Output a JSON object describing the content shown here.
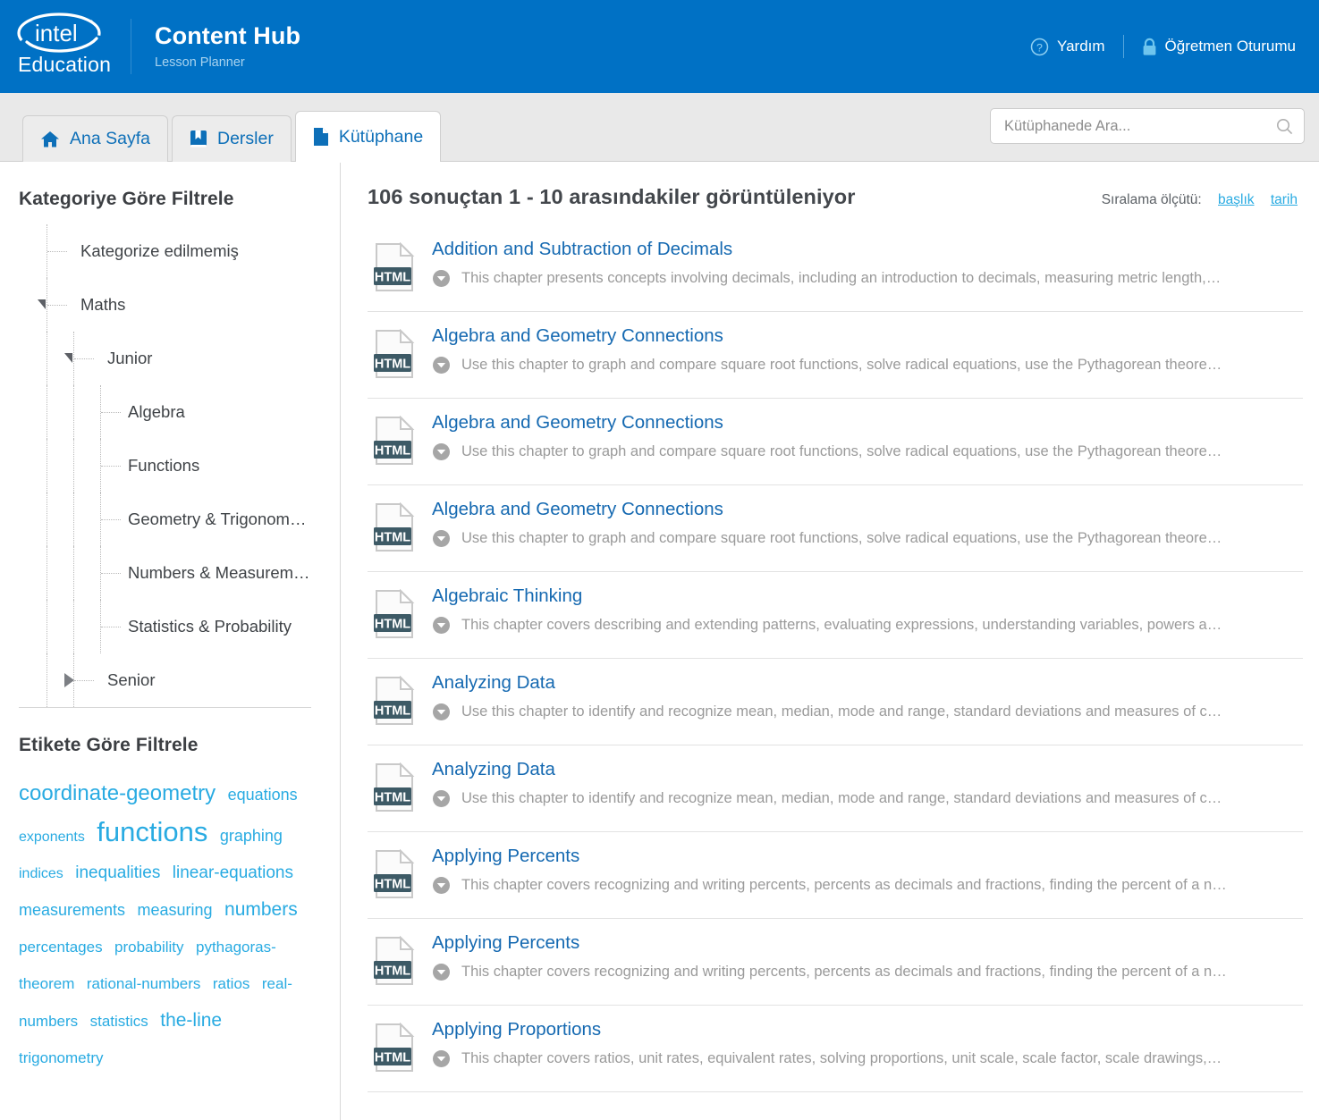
{
  "header": {
    "logo_text": "Education",
    "logo_name": "intel",
    "app_title": "Content Hub",
    "app_subtitle": "Lesson Planner",
    "help_label": "Yardım",
    "help_icon": "question-circle-icon",
    "session_label": "Öğretmen Oturumu",
    "session_icon": "lock-icon",
    "brand_color": "#0071c5"
  },
  "tabs": [
    {
      "label": "Ana Sayfa",
      "icon": "home-icon",
      "active": false
    },
    {
      "label": "Dersler",
      "icon": "book-icon",
      "active": false
    },
    {
      "label": "Kütüphane",
      "icon": "document-icon",
      "active": true
    }
  ],
  "search": {
    "placeholder": "Kütüphanede Ara...",
    "value": "",
    "icon": "search-icon"
  },
  "sidebar": {
    "category_heading": "Kategoriye Göre Filtrele",
    "tag_heading": "Etikete Göre Filtrele",
    "tree": [
      {
        "label": "Kategorize edilmemiş",
        "depth": 0,
        "caret": "none"
      },
      {
        "label": "Maths",
        "depth": 0,
        "caret": "open"
      },
      {
        "label": "Junior",
        "depth": 1,
        "caret": "open"
      },
      {
        "label": "Algebra",
        "depth": 2,
        "caret": "none"
      },
      {
        "label": "Functions",
        "depth": 2,
        "caret": "none"
      },
      {
        "label": "Geometry & Trigonom…",
        "depth": 2,
        "caret": "none"
      },
      {
        "label": "Numbers & Measurem…",
        "depth": 2,
        "caret": "none"
      },
      {
        "label": "Statistics & Probability",
        "depth": 2,
        "caret": "none"
      },
      {
        "label": "Senior",
        "depth": 1,
        "caret": "closed"
      }
    ],
    "tags": [
      {
        "label": "coordinate-geometry",
        "size": 24
      },
      {
        "label": "equations",
        "size": 18
      },
      {
        "label": "exponents",
        "size": 16
      },
      {
        "label": "functions",
        "size": 31
      },
      {
        "label": "graphing",
        "size": 18
      },
      {
        "label": "indices",
        "size": 16
      },
      {
        "label": "inequalities",
        "size": 19
      },
      {
        "label": "linear-equations",
        "size": 19
      },
      {
        "label": "measurements",
        "size": 18
      },
      {
        "label": "measuring",
        "size": 18
      },
      {
        "label": "numbers",
        "size": 21
      },
      {
        "label": "percentages",
        "size": 17
      },
      {
        "label": "probability",
        "size": 17
      },
      {
        "label": "pythagoras-theorem",
        "size": 17
      },
      {
        "label": "rational-numbers",
        "size": 17
      },
      {
        "label": "ratios",
        "size": 17
      },
      {
        "label": "real-numbers",
        "size": 17
      },
      {
        "label": "statistics",
        "size": 17
      },
      {
        "label": "the-line",
        "size": 21
      },
      {
        "label": "trigonometry",
        "size": 17
      }
    ]
  },
  "results_header": {
    "count_text": "106 sonuçtan 1 - 10 arasındakiler görüntüleniyor",
    "sort_label": "Sıralama ölçütü:",
    "sort_options": [
      {
        "label": "başlık"
      },
      {
        "label": "tarih"
      }
    ]
  },
  "results": [
    {
      "title": "Addition and Subtraction of Decimals",
      "description": "This chapter presents concepts involving decimals, including an introduction to decimals, measuring metric length,…",
      "type_badge": "HTML",
      "icon": "html-file-icon"
    },
    {
      "title": "Algebra and Geometry Connections",
      "description": "Use this chapter to graph and compare square root functions, solve radical equations, use the Pythagorean theore…",
      "type_badge": "HTML",
      "icon": "html-file-icon"
    },
    {
      "title": "Algebra and Geometry Connections",
      "description": "Use this chapter to graph and compare square root functions, solve radical equations, use the Pythagorean theore…",
      "type_badge": "HTML",
      "icon": "html-file-icon"
    },
    {
      "title": "Algebra and Geometry Connections",
      "description": "Use this chapter to graph and compare square root functions, solve radical equations, use the Pythagorean theore…",
      "type_badge": "HTML",
      "icon": "html-file-icon"
    },
    {
      "title": "Algebraic Thinking",
      "description": "This chapter covers describing and extending patterns, evaluating expressions, understanding variables, powers a…",
      "type_badge": "HTML",
      "icon": "html-file-icon"
    },
    {
      "title": "Analyzing Data",
      "description": "Use this chapter to identify and recognize mean, median, mode and range, standard deviations and measures of c…",
      "type_badge": "HTML",
      "icon": "html-file-icon"
    },
    {
      "title": "Analyzing Data",
      "description": "Use this chapter to identify and recognize mean, median, mode and range, standard deviations and measures of c…",
      "type_badge": "HTML",
      "icon": "html-file-icon"
    },
    {
      "title": "Applying Percents",
      "description": "This chapter covers recognizing and writing percents, percents as decimals and fractions, finding the percent of a n…",
      "type_badge": "HTML",
      "icon": "html-file-icon"
    },
    {
      "title": "Applying Percents",
      "description": "This chapter covers recognizing and writing percents, percents as decimals and fractions, finding the percent of a n…",
      "type_badge": "HTML",
      "icon": "html-file-icon"
    },
    {
      "title": "Applying Proportions",
      "description": "This chapter covers ratios, unit rates, equivalent rates, solving proportions, unit scale, scale factor, scale drawings,…",
      "type_badge": "HTML",
      "icon": "html-file-icon"
    }
  ],
  "colors": {
    "brand_blue": "#0071c5",
    "link_blue": "#1569b1",
    "tag_blue": "#29abe2",
    "tab_gray": "#e9e9e9"
  }
}
